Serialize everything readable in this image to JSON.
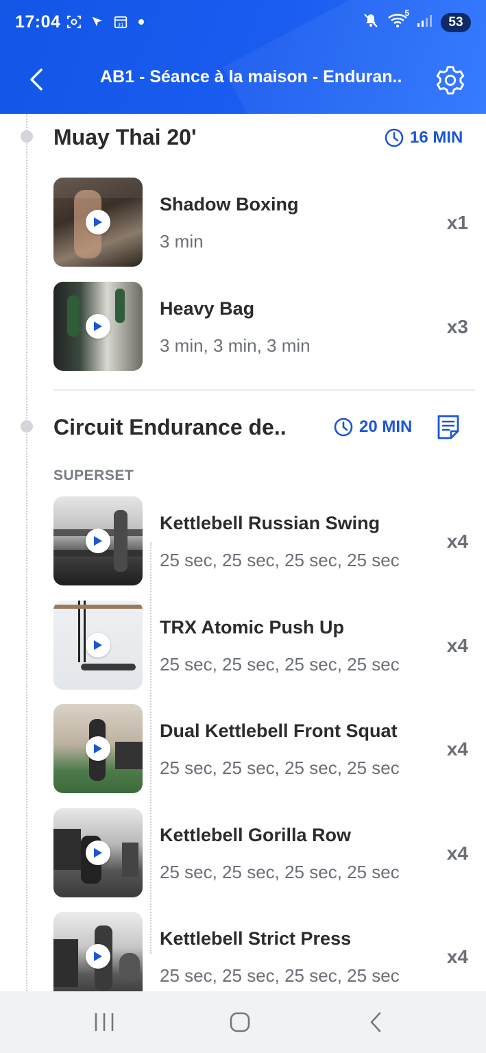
{
  "status_bar": {
    "time": "17:04",
    "battery": "53",
    "signal_badge": "5"
  },
  "header": {
    "title": "AB1 - Séance à la maison - Enduran.."
  },
  "sections": [
    {
      "title": "Muay Thai 20'",
      "duration": "16 MIN",
      "exercises": [
        {
          "name": "Shadow Boxing",
          "detail": "3 min",
          "count": "x1"
        },
        {
          "name": "Heavy Bag",
          "detail": "3 min, 3 min, 3 min",
          "count": "x3"
        }
      ]
    },
    {
      "title": "Circuit Endurance de..",
      "duration": "20 MIN",
      "group_label": "SUPERSET",
      "exercises": [
        {
          "name": "Kettlebell Russian Swing",
          "detail": "25 sec, 25 sec, 25 sec, 25 sec",
          "count": "x4"
        },
        {
          "name": "TRX Atomic Push Up",
          "detail": "25 sec, 25 sec, 25 sec, 25 sec",
          "count": "x4"
        },
        {
          "name": "Dual Kettlebell Front Squat",
          "detail": "25 sec, 25 sec, 25 sec, 25 sec",
          "count": "x4"
        },
        {
          "name": "Kettlebell Gorilla Row",
          "detail": "25 sec, 25 sec, 25 sec, 25 sec",
          "count": "x4"
        },
        {
          "name": "Kettlebell Strict Press",
          "detail": "25 sec, 25 sec, 25 sec, 25 sec",
          "count": "x4"
        }
      ]
    }
  ],
  "icons": {
    "back": "chevron-left-icon",
    "settings": "gear-icon",
    "clock": "clock-icon",
    "notes": "notes-icon",
    "play": "play-icon"
  },
  "colors": {
    "header": "#1a5cf0",
    "accent": "#1a56d6"
  }
}
